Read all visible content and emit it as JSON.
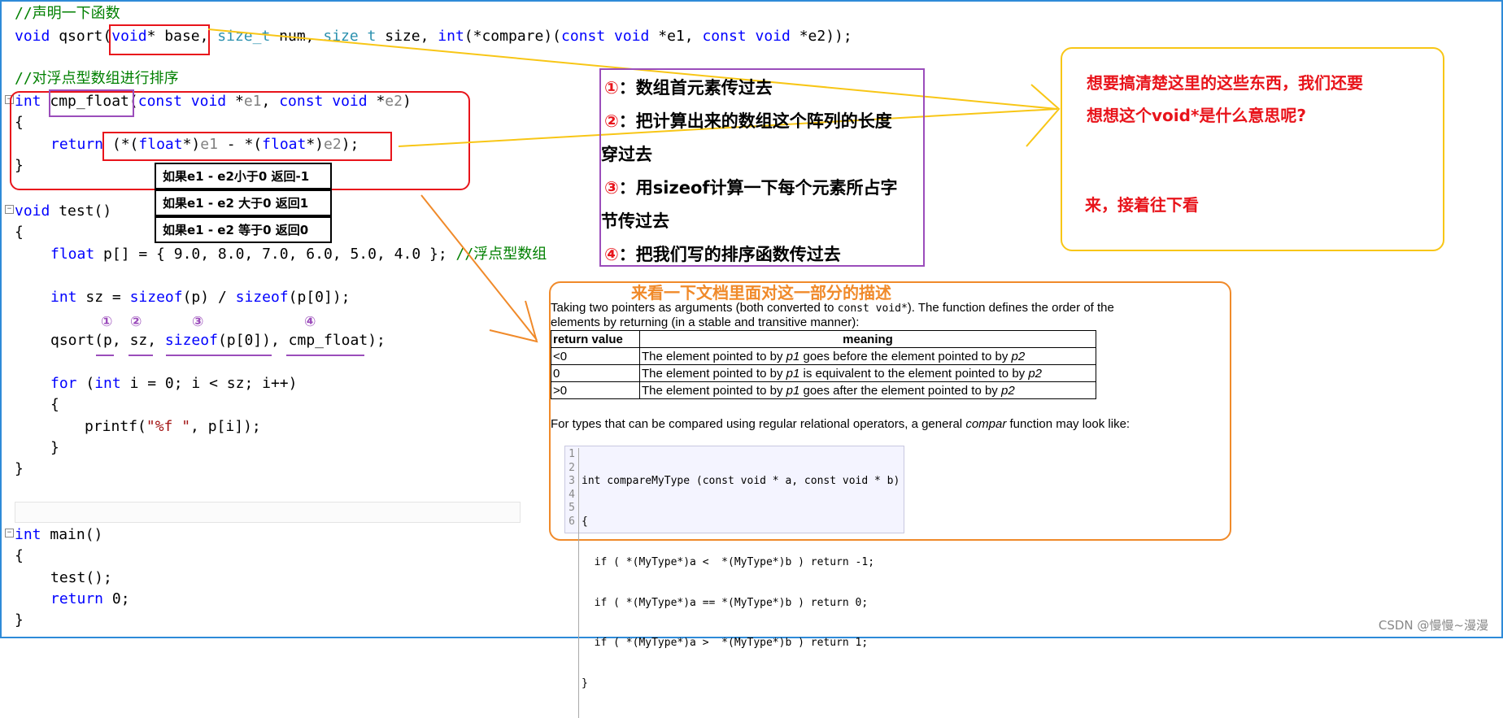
{
  "code": {
    "comment_declare": "//声明一下函数",
    "qsort_decl": {
      "void": "void",
      "name": "qsort",
      "base_type": "void",
      "base_rest": "* base,",
      "size_t1": "size_t",
      "num": "num,",
      "size_t2": "size_t",
      "size": "size,",
      "int": "int",
      "compare": "(*compare)(",
      "const1": "const",
      "void1": "void",
      "e1": "*e1,",
      "const2": "const",
      "void2": "void",
      "e2": "*e2));"
    },
    "comment_sort": "//对浮点型数组进行排序",
    "cmp_float": {
      "int": "int",
      "name": "cmp_float",
      "params_open": "(",
      "const1": "const",
      "void1": "void",
      "star1": "*",
      "e1": "e1",
      "comma": ",",
      "const2": "const",
      "void2": "void",
      "star2": "*",
      "e2": "e2",
      "params_close": ")",
      "brace_open": "{",
      "return": "return",
      "expr1": "(*(",
      "float1": "float",
      "expr2": "*)",
      "e1b": "e1",
      "expr3": " - *(",
      "float2": "float",
      "expr4": "*)",
      "e2b": "e2",
      "expr5": ");",
      "brace_close": "}"
    },
    "test": {
      "void": "void",
      "sig": "test()",
      "brace_open": "{",
      "float": "float",
      "array": "p[] = { 9.0, 8.0, 7.0, 6.0, 5.0, 4.0 };",
      "array_comment": "//浮点型数组",
      "int": "int",
      "sz_decl": "sz =",
      "sizeof1": "sizeof",
      "sz_mid": "(p) /",
      "sizeof2": "sizeof",
      "sz_end": "(p[0]);",
      "qsort_call_pre": "qsort(",
      "arg1": "p,",
      "arg2": "sz,",
      "arg3_kw": "sizeof",
      "arg3_rest": "(p[0]),",
      "arg4": "cmp_float",
      "call_end": ");",
      "for": "for",
      "for_open": "(",
      "for_int": "int",
      "for_rest": "i = 0; i < sz; i++)",
      "inner_open": "{",
      "printf": "printf(",
      "fmt": "\"%f \"",
      "printf_rest": ", p[i]);",
      "inner_close": "}",
      "brace_close": "}"
    },
    "main": {
      "int": "int",
      "sig": "main()",
      "brace_open": "{",
      "call": "test();",
      "return": "return",
      "ret_val": "0;",
      "brace_close": "}"
    }
  },
  "arg_numbers": [
    "①",
    "②",
    "③",
    "④"
  ],
  "return_notes": [
    "如果e1 - e2小于0 返回-1",
    "如果e1 - e2 大于0 返回1",
    "如果e1 - e2 等于0 返回0"
  ],
  "arg_explanations": [
    {
      "num": "①",
      "text": "：数组首元素传过去"
    },
    {
      "num": "②",
      "text": "：把计算出来的数组这个阵列的长度",
      "text2": "穿过去"
    },
    {
      "num": "③",
      "text": "：用sizeof计算一下每个元素所占字",
      "text2": "节传过去"
    },
    {
      "num": "④",
      "text": "：把我们写的排序函数传过去"
    }
  ],
  "question_box": {
    "line1": "想要搞清楚这里的这些东西，我们还要",
    "line2": "想想这个void*是什么意思呢?",
    "line3": "来，接着往下看"
  },
  "doc_section": {
    "heading": "来看一下文档里面对这一部分的描述",
    "intro_1": "Taking two pointers as arguments (both converted to",
    "intro_code": "const void*",
    "intro_2": "). The function defines the order of the",
    "intro_3": "elements by returning (in a stable and transitive manner):",
    "table": {
      "headers": [
        "return value",
        "meaning"
      ],
      "rows": [
        {
          "value": "<0",
          "meaning_a": "The element pointed to by ",
          "p1": "p1",
          "meaning_b": " goes before the element pointed to by ",
          "p2": "p2"
        },
        {
          "value": "0",
          "meaning_a": "The element pointed to by ",
          "p1": "p1",
          "meaning_b": " is equivalent to the element pointed to by ",
          "p2": "p2"
        },
        {
          "value": ">0",
          "meaning_a": "The element pointed to by ",
          "p1": "p1",
          "meaning_b": " goes after the element pointed to by ",
          "p2": "p2"
        }
      ]
    },
    "types_1": "For types that can be compared using regular relational operators, a general",
    "types_compar": "compar",
    "types_2": "function may look like:",
    "code_lines_nums": "1\n2\n3\n4\n5\n6",
    "code_lines": [
      "int compareMyType (const void * a, const void * b)",
      "{",
      "  if ( *(MyType*)a <  *(MyType*)b ) return -1;",
      "  if ( *(MyType*)a == *(MyType*)b ) return 0;",
      "  if ( *(MyType*)a >  *(MyType*)b ) return 1;",
      "}"
    ]
  },
  "watermark": "CSDN @慢慢~漫漫",
  "colors": {
    "frame": "#2e8bd8",
    "red_annotation": "#e8141b",
    "purple_annotation": "#9b4dbb",
    "yellow_annotation": "#f8c616",
    "orange_annotation": "#f08a2a"
  }
}
